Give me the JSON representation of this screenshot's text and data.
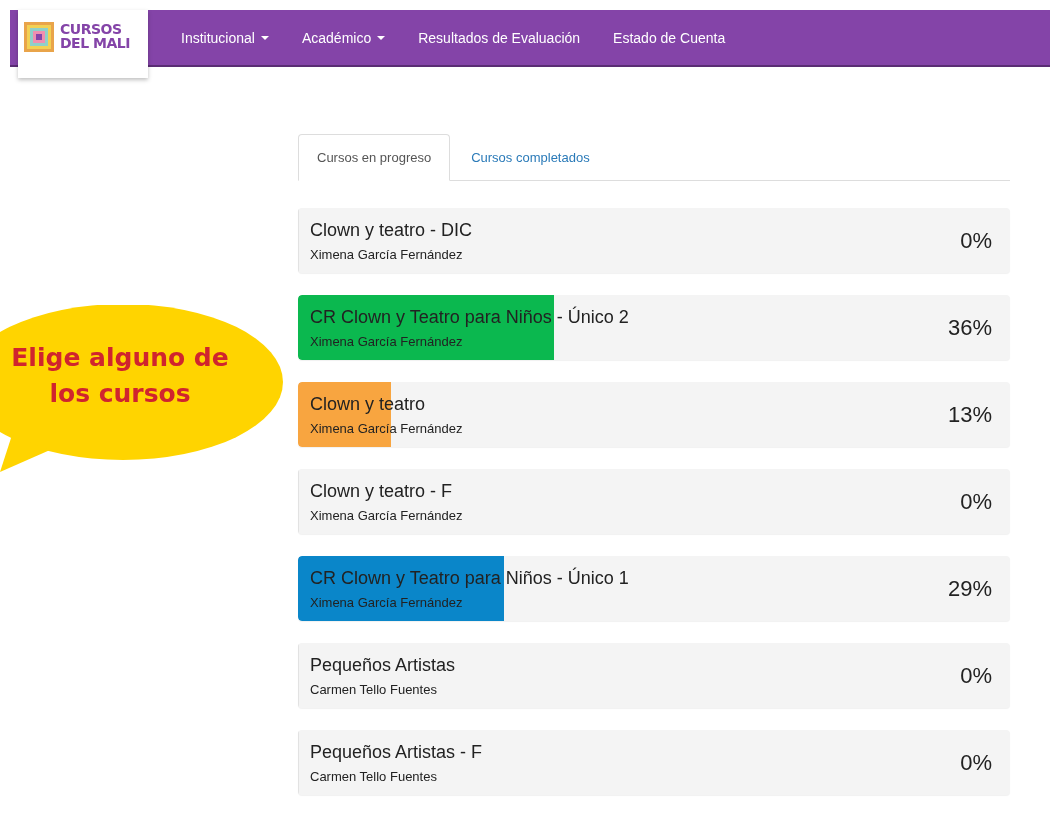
{
  "brand": {
    "lines": [
      "CURSOS",
      "DEL MALI"
    ]
  },
  "nav": [
    {
      "label": "Institucional",
      "dropdown": true
    },
    {
      "label": "Académico",
      "dropdown": true
    },
    {
      "label": "Resultados de Evaluación",
      "dropdown": false
    },
    {
      "label": "Estado de Cuenta",
      "dropdown": false
    }
  ],
  "callout": {
    "text": "Elige alguno de los cursos"
  },
  "tabs": [
    {
      "label": "Cursos en progreso",
      "selected": true
    },
    {
      "label": "Cursos completados",
      "selected": false
    }
  ],
  "courses": [
    {
      "title": "Clown y teatro - DIC",
      "teacher": "Ximena García Fernández",
      "percent": "0%",
      "level": 0
    },
    {
      "title": "CR Clown y Teatro para Niños - Único 2",
      "teacher": "Ximena García Fernández",
      "percent": "36%",
      "level": 0.36,
      "color": "#0bb84f"
    },
    {
      "title": "Clown y teatro",
      "teacher": "Ximena García Fernández",
      "percent": "13%",
      "level": 0.13,
      "color": "#f8a540"
    },
    {
      "title": "Clown y teatro - F",
      "teacher": "Ximena García Fernández",
      "percent": "0%",
      "level": 0
    },
    {
      "title": "CR Clown y Teatro para Niños - Único 1",
      "teacher": "Ximena García Fernández",
      "percent": "29%",
      "level": 0.29,
      "color": "#0a86c9"
    },
    {
      "title": "Pequeños Artistas",
      "teacher": "Carmen Tello Fuentes",
      "percent": "0%",
      "level": 0
    },
    {
      "title": "Pequeños Artistas - F",
      "teacher": "Carmen Tello Fuentes",
      "percent": "0%",
      "level": 0
    }
  ]
}
